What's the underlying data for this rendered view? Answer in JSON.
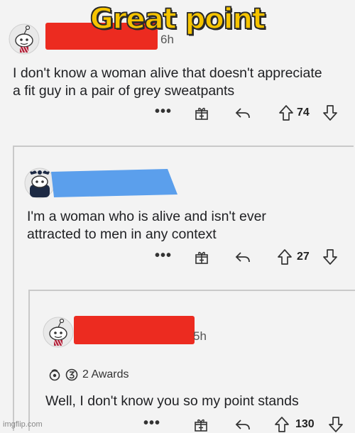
{
  "caption": "Great point",
  "comments": [
    {
      "username_color": "#ec2b20",
      "time_suffix": "6h",
      "line1": "I don't know a woman alive that doesn't appreciate",
      "line2": "a fit guy in a pair of grey sweatpants",
      "more_icon": "•••",
      "votes": "74"
    },
    {
      "username_color": "#5b9fec",
      "line1": "I'm a woman who is alive and isn't ever",
      "line2": "attracted to men in any context",
      "more_icon": "•••",
      "votes": "27"
    },
    {
      "username_color": "#ec2b20",
      "time_suffix": "5h",
      "awards_label": "2 Awards",
      "line1": "Well, I don't know you so my point stands",
      "more_icon": "•••",
      "votes": "130"
    }
  ],
  "icons": [
    "avatar-icon",
    "gift-icon",
    "reply-icon",
    "upvote-icon",
    "downvote-icon",
    "award-icon"
  ],
  "watermark": "imgflip.com"
}
